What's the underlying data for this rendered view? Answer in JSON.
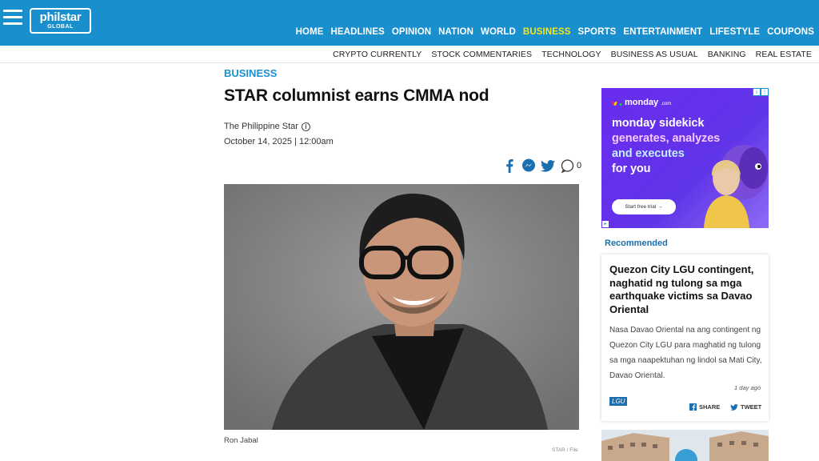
{
  "header": {
    "logo": {
      "line1": "philstar",
      "line2": "GLOBAL"
    },
    "main_nav": [
      "HOME",
      "HEADLINES",
      "OPINION",
      "NATION",
      "WORLD",
      "BUSINESS",
      "SPORTS",
      "ENTERTAINMENT",
      "LIFESTYLE",
      "COUPONS"
    ],
    "active_nav": "BUSINESS",
    "sub_nav": [
      "CRYPTO CURRENTLY",
      "STOCK COMMENTARIES",
      "TECHNOLOGY",
      "BUSINESS AS USUAL",
      "BANKING",
      "REAL ESTATE"
    ]
  },
  "article": {
    "section": "BUSINESS",
    "title": "STAR columnist earns CMMA nod",
    "source": "The Philippine Star",
    "date": "October 14, 2025 | 12:00am",
    "comment_count": "0",
    "caption": "Ron Jabal",
    "photo_credit": "STAR / File"
  },
  "ad": {
    "brand": "monday",
    "brand_suffix": ".com",
    "lines": [
      "monday sidekick",
      "generates, analyzes",
      "and executes",
      "for you"
    ],
    "cta": "Start free trial →"
  },
  "recommended": {
    "heading": "Recommended",
    "card": {
      "title": "Quezon City LGU contingent, naghatid ng tulong sa mga earthquake victims sa Davao Oriental",
      "body": "Nasa Davao Oriental na ang contingent ng Quezon City LGU para maghatid ng tulong sa mga naapektuhan ng lindol sa Mati City, Davao Oriental.",
      "time_ago": "1 day ago",
      "tag": "LGU",
      "share_label": "SHARE",
      "tweet_label": "TWEET"
    }
  },
  "colors": {
    "header_blue": "#1a8fce",
    "active_nav": "#f5e61b",
    "section_blue": "#1a8fce",
    "ad_purple": "#6a2cf0"
  }
}
